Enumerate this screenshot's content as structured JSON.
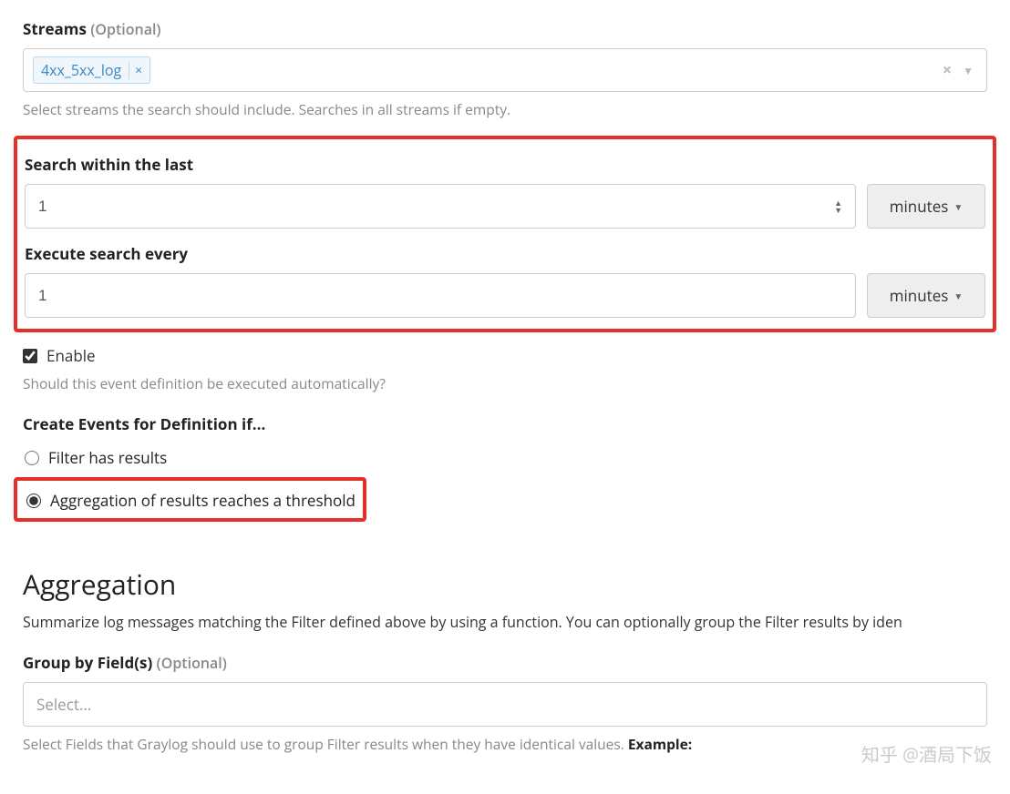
{
  "streams": {
    "label": "Streams",
    "optional": "(Optional)",
    "tag": "4xx_5xx_log",
    "help": "Select streams the search should include. Searches in all streams if empty."
  },
  "search_within": {
    "label": "Search within the last",
    "value": "1",
    "unit": "minutes"
  },
  "execute_every": {
    "label": "Execute search every",
    "value": "1",
    "unit": "minutes"
  },
  "enable": {
    "label": "Enable",
    "help": "Should this event definition be executed automatically?"
  },
  "create_events": {
    "title": "Create Events for Definition if...",
    "opt_filter": "Filter has results",
    "opt_agg": "Aggregation of results reaches a threshold"
  },
  "aggregation": {
    "heading": "Aggregation",
    "desc": "Summarize log messages matching the Filter defined above by using a function. You can optionally group the Filter results by iden"
  },
  "group_by": {
    "label": "Group by Field(s)",
    "optional": "(Optional)",
    "placeholder": "Select...",
    "help_prefix": "Select Fields that Graylog should use to group Filter results when they have identical values. ",
    "help_bold": "Example:"
  },
  "watermark": "知乎 @酒局下饭"
}
